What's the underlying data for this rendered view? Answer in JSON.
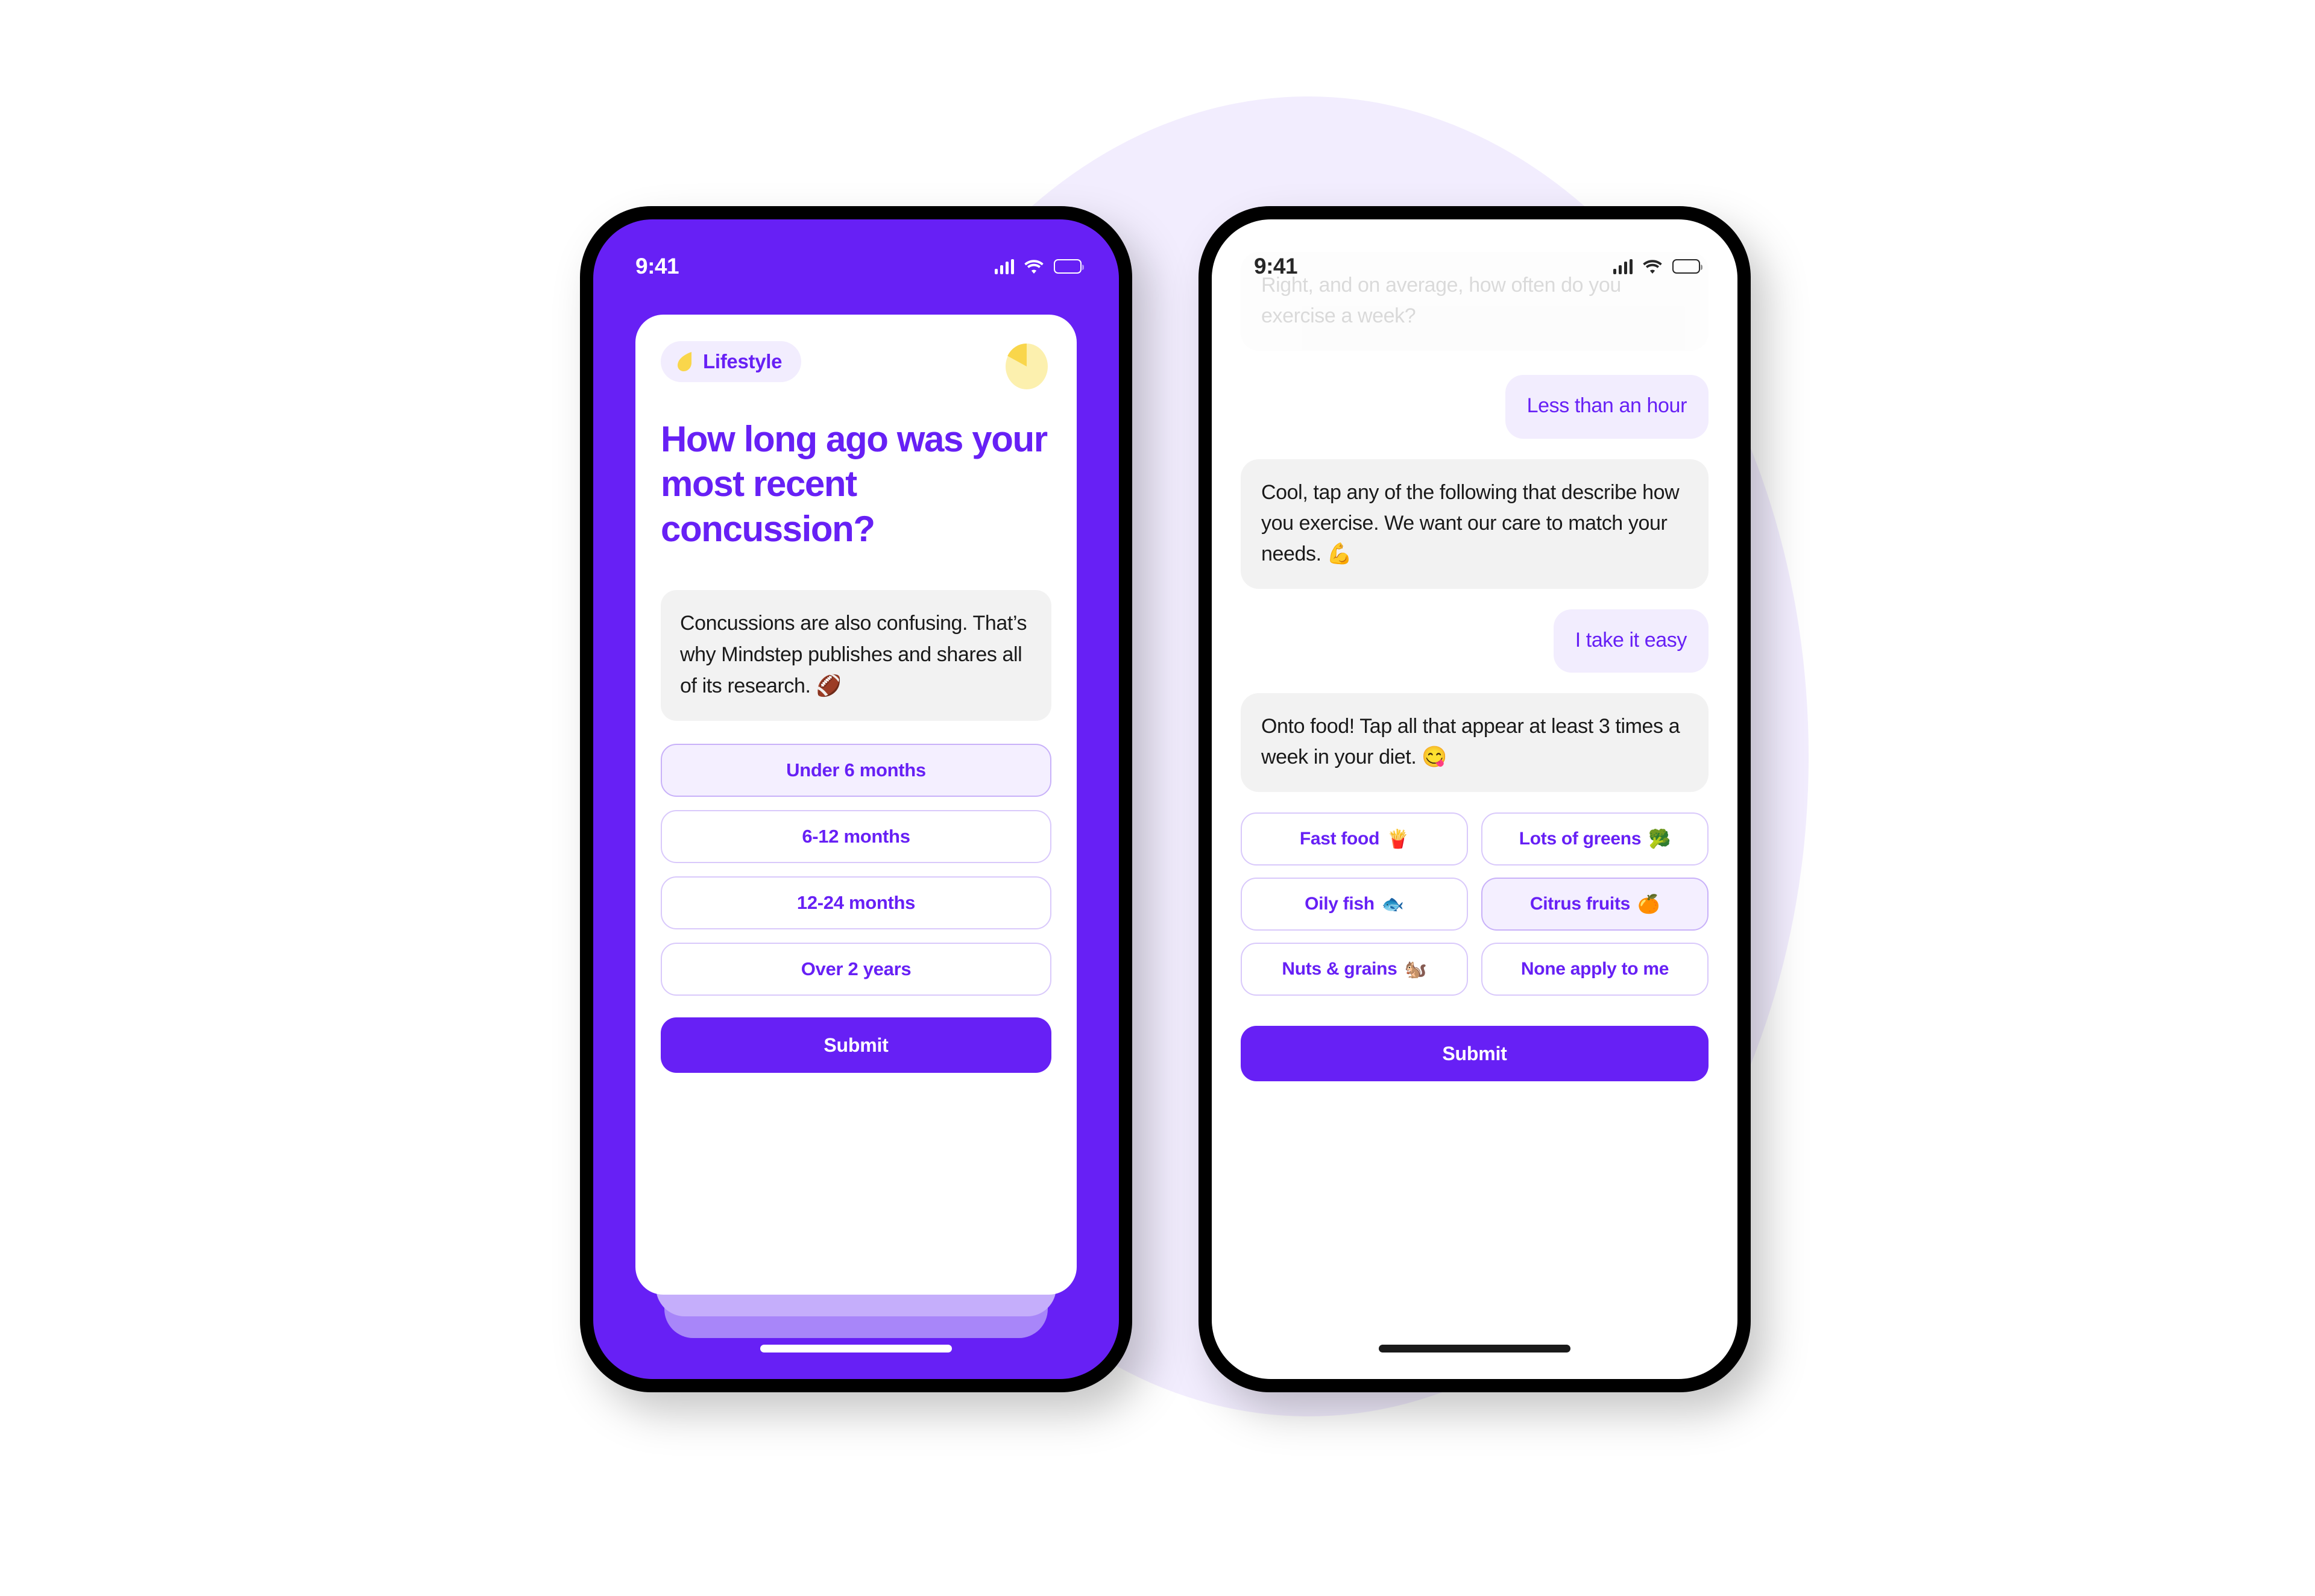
{
  "theme": {
    "brand_purple": "#6720f5",
    "pale_lavender": "#f2edfe",
    "bubble_gray": "#f2f2f2",
    "accent_yellow": "#f9d64b",
    "border_lilac": "#d9c9fb"
  },
  "left_phone": {
    "status": {
      "time": "9:41",
      "cell_icon": "cellular-icon",
      "wifi_icon": "wifi-icon",
      "battery_icon": "battery-icon"
    },
    "card": {
      "category_badge": {
        "label": "Lifestyle",
        "icon": "leaf-icon"
      },
      "progress_icon": "pie-chart-icon",
      "question": "How long ago was your most recent concussion?",
      "info_note": "Concussions are also confusing. That’s why Mindstep publishes and shares all of its research. 🏈",
      "options": [
        {
          "label": "Under 6 months",
          "selected": true
        },
        {
          "label": "6-12 months",
          "selected": false
        },
        {
          "label": "12-24 months",
          "selected": false
        },
        {
          "label": "Over 2 years",
          "selected": false
        }
      ],
      "submit_label": "Submit"
    }
  },
  "right_phone": {
    "status": {
      "time": "9:41",
      "cell_icon": "cellular-icon",
      "wifi_icon": "wifi-icon",
      "battery_icon": "battery-icon"
    },
    "chat": {
      "messages": [
        {
          "from": "bot",
          "text": "Right, and on average, how often do you exercise a week?",
          "faded": true
        },
        {
          "from": "user",
          "text": "Less than an hour"
        },
        {
          "from": "bot",
          "text": "Cool, tap any of the following that describe how you exercise. We want our care to match your needs. 💪"
        },
        {
          "from": "user",
          "text": "I take it easy"
        },
        {
          "from": "bot",
          "text": "Onto food! Tap all that appear at least 3 times a week in your diet. 😋"
        }
      ],
      "food_chips": [
        {
          "label": "Fast food",
          "emoji": "🍟",
          "selected": false
        },
        {
          "label": "Lots of greens",
          "emoji": "🥦",
          "selected": false
        },
        {
          "label": "Oily fish",
          "emoji": "🐟",
          "selected": false
        },
        {
          "label": "Citrus fruits",
          "emoji": "🍊",
          "selected": true
        },
        {
          "label": "Nuts & grains",
          "emoji": "🐿️",
          "selected": false
        },
        {
          "label": "None apply to me",
          "emoji": "",
          "selected": false
        }
      ],
      "submit_label": "Submit"
    }
  }
}
